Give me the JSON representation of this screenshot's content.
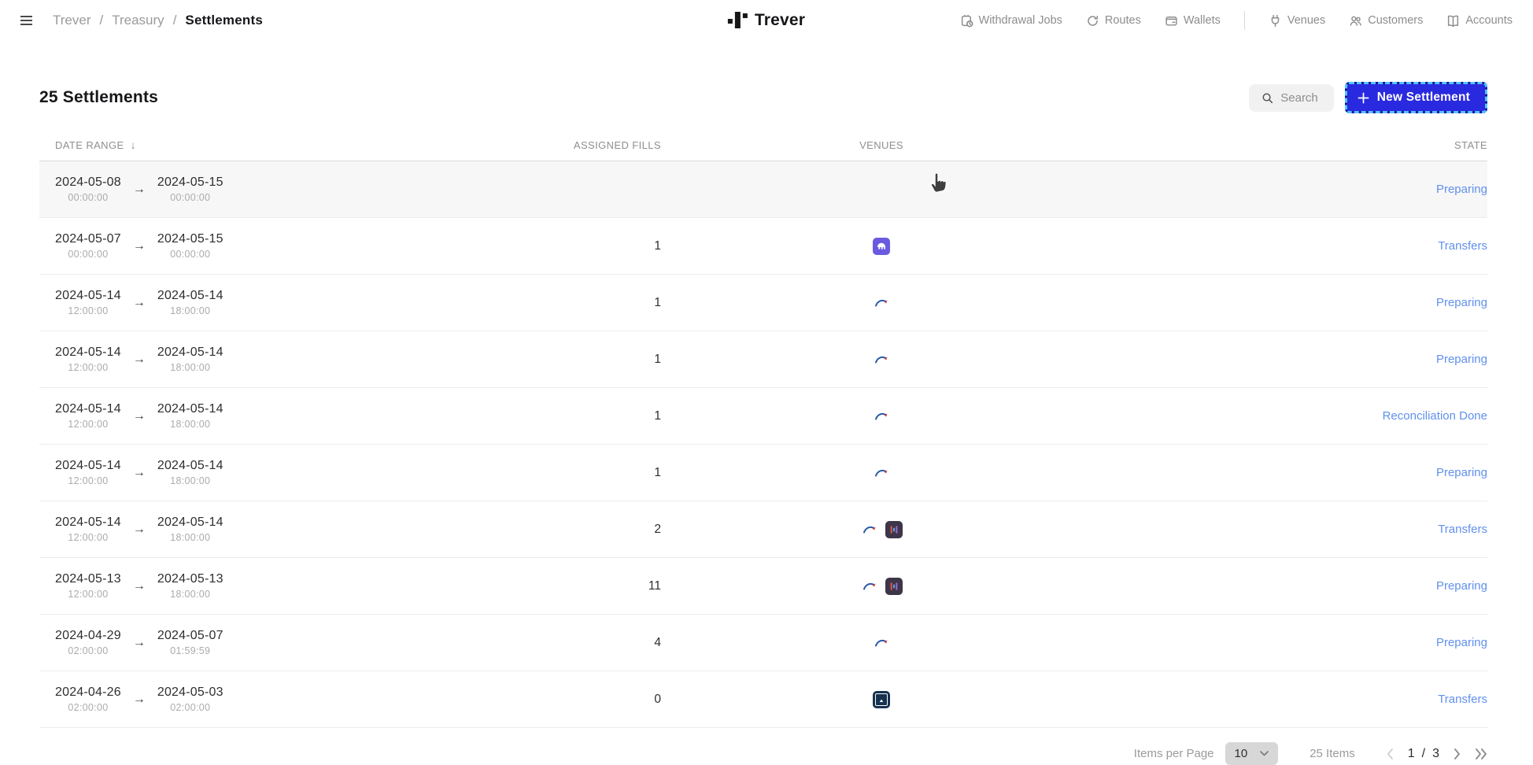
{
  "header": {
    "breadcrumb": {
      "items": [
        "Trever",
        "Treasury"
      ],
      "separator": "/",
      "current": "Settlements"
    },
    "logo_text": "Trever",
    "nav": [
      {
        "label": "Withdrawal Jobs",
        "icon": "clipboard-clock-icon"
      },
      {
        "label": "Routes",
        "icon": "route-refresh-icon"
      },
      {
        "label": "Wallets",
        "icon": "wallet-icon"
      },
      {
        "label": "Venues",
        "icon": "plug-icon"
      },
      {
        "label": "Customers",
        "icon": "users-icon"
      },
      {
        "label": "Accounts",
        "icon": "book-icon"
      }
    ]
  },
  "toolbar": {
    "title": "25 Settlements",
    "search_label": "Search",
    "new_settlement_label": "New Settlement"
  },
  "table": {
    "columns": {
      "date_range": "DATE RANGE",
      "assigned_fills": "ASSIGNED FILLS",
      "venues": "VENUES",
      "state": "STATE"
    },
    "sort_icon": "↓",
    "range_arrow": "→",
    "rows": [
      {
        "start_date": "2024-05-08",
        "start_time": "00:00:00",
        "end_date": "2024-05-15",
        "end_time": "00:00:00",
        "fills": "",
        "venues": [],
        "state": "Preparing"
      },
      {
        "start_date": "2024-05-07",
        "start_time": "00:00:00",
        "end_date": "2024-05-15",
        "end_time": "00:00:00",
        "fills": "1",
        "venues": [
          "kraken"
        ],
        "state": "Transfers"
      },
      {
        "start_date": "2024-05-14",
        "start_time": "12:00:00",
        "end_date": "2024-05-14",
        "end_time": "18:00:00",
        "fills": "1",
        "venues": [
          "red-swoosh"
        ],
        "state": "Preparing"
      },
      {
        "start_date": "2024-05-14",
        "start_time": "12:00:00",
        "end_date": "2024-05-14",
        "end_time": "18:00:00",
        "fills": "1",
        "venues": [
          "red-swoosh"
        ],
        "state": "Preparing"
      },
      {
        "start_date": "2024-05-14",
        "start_time": "12:00:00",
        "end_date": "2024-05-14",
        "end_time": "18:00:00",
        "fills": "1",
        "venues": [
          "red-swoosh"
        ],
        "state": "Reconciliation Done"
      },
      {
        "start_date": "2024-05-14",
        "start_time": "12:00:00",
        "end_date": "2024-05-14",
        "end_time": "18:00:00",
        "fills": "1",
        "venues": [
          "red-swoosh"
        ],
        "state": "Preparing"
      },
      {
        "start_date": "2024-05-14",
        "start_time": "12:00:00",
        "end_date": "2024-05-14",
        "end_time": "18:00:00",
        "fills": "2",
        "venues": [
          "red-swoosh",
          "bar-chart"
        ],
        "state": "Transfers"
      },
      {
        "start_date": "2024-05-13",
        "start_time": "12:00:00",
        "end_date": "2024-05-13",
        "end_time": "18:00:00",
        "fills": "11",
        "venues": [
          "red-swoosh",
          "bar-chart"
        ],
        "state": "Preparing"
      },
      {
        "start_date": "2024-04-29",
        "start_time": "02:00:00",
        "end_date": "2024-05-07",
        "end_time": "01:59:59",
        "fills": "4",
        "venues": [
          "red-swoosh"
        ],
        "state": "Preparing"
      },
      {
        "start_date": "2024-04-26",
        "start_time": "02:00:00",
        "end_date": "2024-05-03",
        "end_time": "02:00:00",
        "fills": "0",
        "venues": [
          "navy-square"
        ],
        "state": "Transfers"
      }
    ]
  },
  "footer": {
    "items_per_page_label": "Items per Page",
    "items_per_page_value": "10",
    "items_count": "25 Items",
    "page_current": "1",
    "page_separator": "/",
    "page_total": "3"
  },
  "colors": {
    "accent": "#2929e0",
    "focus_ring": "#54c2ff",
    "state_link": "#6190ec"
  }
}
